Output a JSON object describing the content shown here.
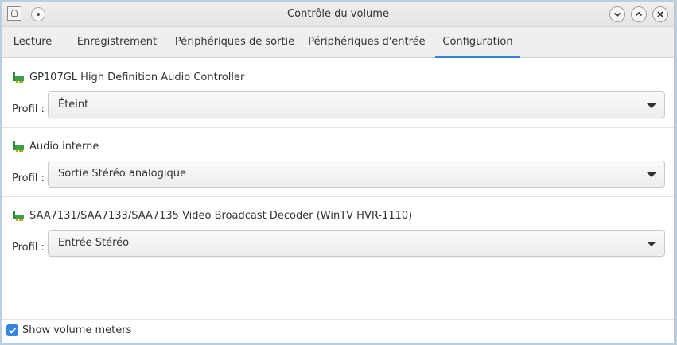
{
  "window": {
    "title": "Contrôle du volume",
    "controls": {
      "minimize_icon": "chevron-down-icon",
      "maximize_icon": "chevron-up-icon",
      "close_icon": "close-icon"
    }
  },
  "tabs": [
    {
      "label": "Lecture",
      "active": false
    },
    {
      "label": "Enregistrement",
      "active": false
    },
    {
      "label": "Périphériques de sortie",
      "active": false
    },
    {
      "label": "Périphériques d'entrée",
      "active": false
    },
    {
      "label": "Configuration",
      "active": true
    }
  ],
  "cards": [
    {
      "name": "GP107GL High Definition Audio Controller",
      "profile_label": "Profil :",
      "profile_value": "Éteint"
    },
    {
      "name": "Audio interne",
      "profile_label": "Profil :",
      "profile_value": "Sortie Stéréo analogique"
    },
    {
      "name": "SAA7131/SAA7133/SAA7135 Video Broadcast Decoder (WinTV HVR-1110)",
      "profile_label": "Profil :",
      "profile_value": "Entrée Stéréo"
    }
  ],
  "footer": {
    "show_meters_label": "Show volume meters",
    "show_meters_checked": true
  },
  "colors": {
    "accent": "#3584e4",
    "card_icon_green": "#2e8b3a"
  }
}
